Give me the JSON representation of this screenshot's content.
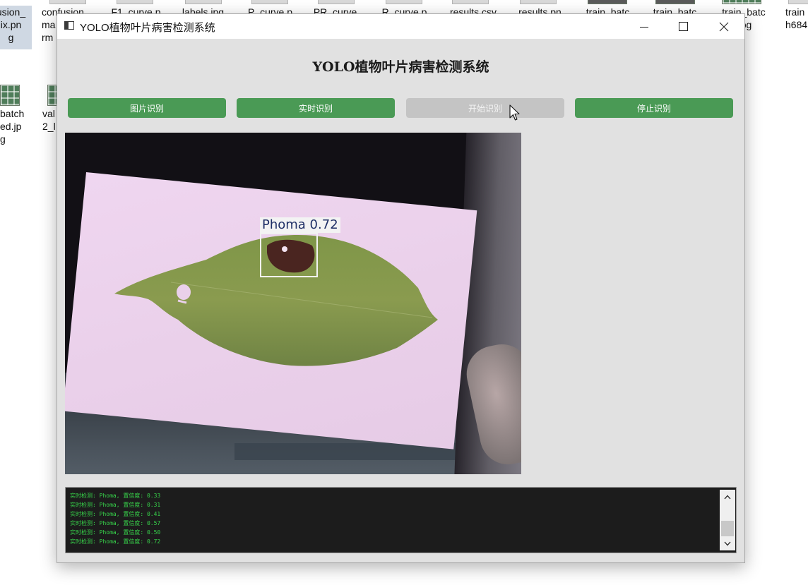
{
  "desktop": {
    "top_row": [
      "usion_\nix.pn\ng",
      "confusion_\nma\nrm",
      "F1_curve.p",
      "labels.jpg",
      "P_curve.p",
      "PR_curve.",
      "R_curve.p",
      "results.csv",
      "results.pn",
      "train_batc",
      "train_batc",
      "train_batc\n.jpg",
      "train\nh684"
    ],
    "left_column": [
      "batch\ned.jp\ng",
      "val\n2_l"
    ]
  },
  "window": {
    "title": "YOLO植物叶片病害检测系统",
    "heading": "YOLO植物叶片病害检测系统",
    "buttons": {
      "image_detect": "图片识别",
      "realtime_detect": "实时识别",
      "start_detect": "开始识别",
      "stop_detect": "停止识别"
    },
    "start_detect_disabled": true,
    "colors": {
      "button_green": "#4a9a55",
      "button_disabled": "#c4c4c4",
      "log_text": "#37d24a"
    }
  },
  "detection": {
    "label": "Phoma 0.72",
    "class": "Phoma",
    "confidence": 0.72
  },
  "log": {
    "lines": [
      "实时检测: Phoma, 置信度: 0.33",
      "实时检测: Phoma, 置信度: 0.31",
      "实时检测: Phoma, 置信度: 0.41",
      "实时检测: Phoma, 置信度: 0.57",
      "实时检测: Phoma, 置信度: 0.50",
      "实时检测: Phoma, 置信度: 0.72"
    ]
  }
}
